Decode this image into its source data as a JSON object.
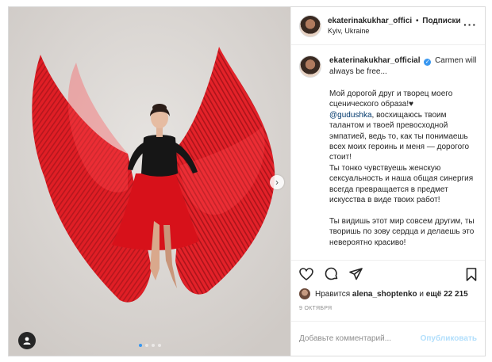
{
  "header": {
    "username": "ekaterinakukhar_offici",
    "separator": "•",
    "follow_label": "Подписки",
    "location": "Kyiv, Ukraine",
    "more_icon": "more-horizontal-icon"
  },
  "post": {
    "username": "ekaterinakukhar_official",
    "caption_intro": "Carmen will always be free...",
    "caption_p1": "Мой дорогой друг и творец моего сценического образа!♥",
    "mention": "@gudushka",
    "caption_p2": ", восхищаюсь твоим талантом и твоей превосходной эмпатией, ведь то, как ты понимаешь всех моих героинь и меня — дорогого стоит!\nТы тонко чувствуешь женскую сексуальность и наша общая синергия всегда превращается в предмет искусства в виде твоих работ!\n\nТы видишь этот мир совсем другим, ты творишь по зову сердца и делаешь это невероятно красиво!",
    "likes_prefix": "Нравится",
    "likes_user": "alena_shoptenko",
    "likes_suffix": "и",
    "likes_count": "ещё 22 215",
    "date": "9 ОКТЯБРЯ"
  },
  "comment_box": {
    "placeholder": "Добавьте комментарий...",
    "publish_label": "Опубликовать"
  },
  "carousel": {
    "total": 4,
    "active_index": 0
  },
  "colors": {
    "dress_red": "#e0141c",
    "accent_blue": "#3897f0",
    "publish_disabled": "#b2dffc"
  }
}
